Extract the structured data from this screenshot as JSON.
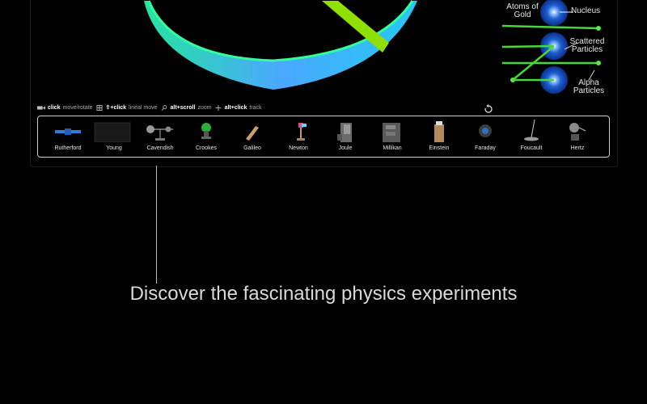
{
  "legend": {
    "atoms_line1": "Atoms of",
    "atoms_line2": "Gold",
    "nucleus": "Nucleus",
    "scattered_line1": "Scattered",
    "scattered_line2": "Particles",
    "alpha_line1": "Alpha",
    "alpha_line2": "Particles"
  },
  "hints": {
    "click": "click",
    "move_rotate": "move/rotate",
    "shift_click": "⇧+click",
    "lineal_move": "lineal move",
    "alt_scroll": "alt+scroll",
    "zoom": "zoom",
    "alt_click": "alt+click",
    "track": "track"
  },
  "experiments": [
    {
      "label": "Rutherford",
      "icon": "rutherford-apparatus-icon"
    },
    {
      "label": "Young",
      "icon": "young-screen-icon"
    },
    {
      "label": "Cavendish",
      "icon": "cavendish-balance-icon"
    },
    {
      "label": "Crookes",
      "icon": "crookes-tube-icon"
    },
    {
      "label": "Galileo",
      "icon": "galileo-ramp-icon"
    },
    {
      "label": "Newton",
      "icon": "newton-prism-icon"
    },
    {
      "label": "Joule",
      "icon": "joule-apparatus-icon"
    },
    {
      "label": "Millikan",
      "icon": "millikan-apparatus-icon"
    },
    {
      "label": "Einstein",
      "icon": "einstein-apparatus-icon"
    },
    {
      "label": "Faraday",
      "icon": "faraday-apparatus-icon"
    },
    {
      "label": "Foucault",
      "icon": "foucault-pendulum-icon"
    },
    {
      "label": "Hertz",
      "icon": "hertz-apparatus-icon"
    }
  ],
  "caption": "Discover the fascinating physics experiments",
  "colors": {
    "ring_top": "#2bff9a",
    "ring_side": "#3ab8ff",
    "beam": "#8ee000",
    "particle_line": "#44d84a",
    "nucleus": "#1f63d6"
  }
}
